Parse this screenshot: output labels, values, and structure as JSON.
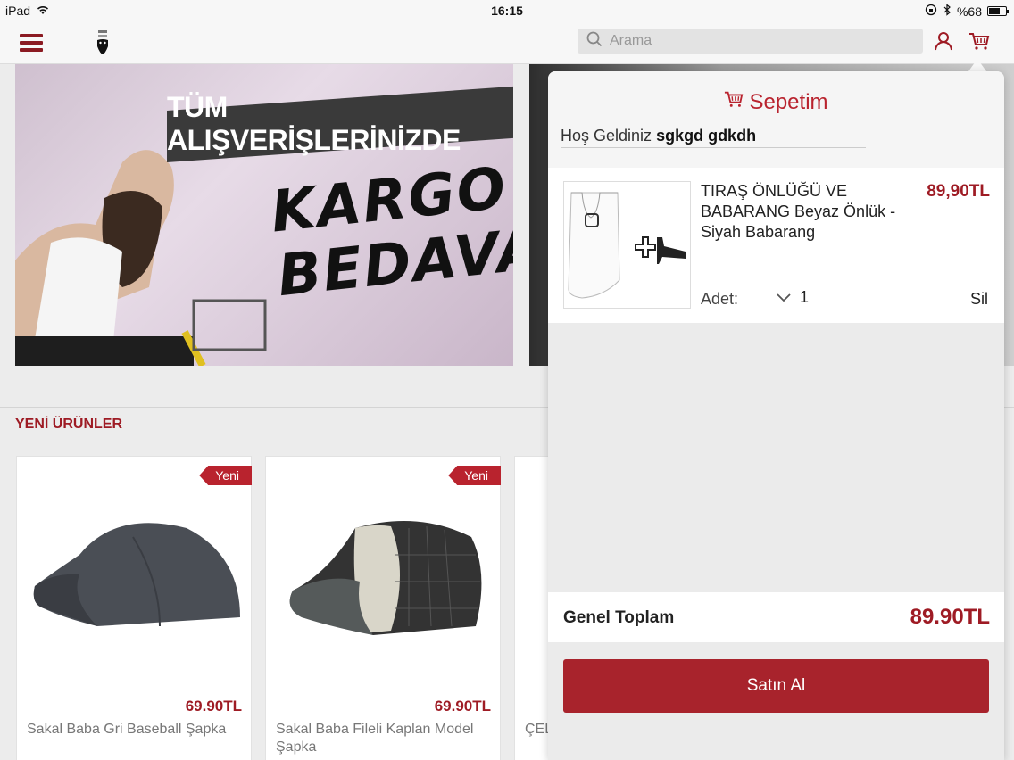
{
  "status_bar": {
    "device": "iPad",
    "time": "16:15",
    "battery": "%68",
    "battery_level": 0.68
  },
  "header": {
    "search_placeholder": "Arama"
  },
  "banner": {
    "strip_text": "TÜM ALIŞVERİŞLERİNİZDE",
    "big_text_line1": "KARGO",
    "big_text_line2": "BEDAVA"
  },
  "section": {
    "title": "YENİ ÜRÜNLER"
  },
  "products": [
    {
      "badge": "Yeni",
      "price": "69.90TL",
      "name": "Sakal Baba Gri Baseball Şapka"
    },
    {
      "badge": "Yeni",
      "price": "69.90TL",
      "name": "Sakal Baba Fileli Kaplan Model Şapka"
    },
    {
      "name_partial": "ÇEL"
    }
  ],
  "cart": {
    "title": "Sepetim",
    "welcome_prefix": "Hoş Geldiniz",
    "username": "sgkgd gdkdh",
    "items": [
      {
        "title": "TIRAŞ ÖNLÜĞÜ VE BABARANG Beyaz Önlük - Siyah Babarang",
        "price": "89,90TL",
        "qty_label": "Adet:",
        "qty": "1",
        "remove": "Sil"
      }
    ],
    "total_label": "Genel Toplam",
    "total_value": "89.90TL",
    "buy_label": "Satın Al"
  },
  "colors": {
    "accent": "#9e1b24",
    "buy_button": "#a8232c"
  }
}
